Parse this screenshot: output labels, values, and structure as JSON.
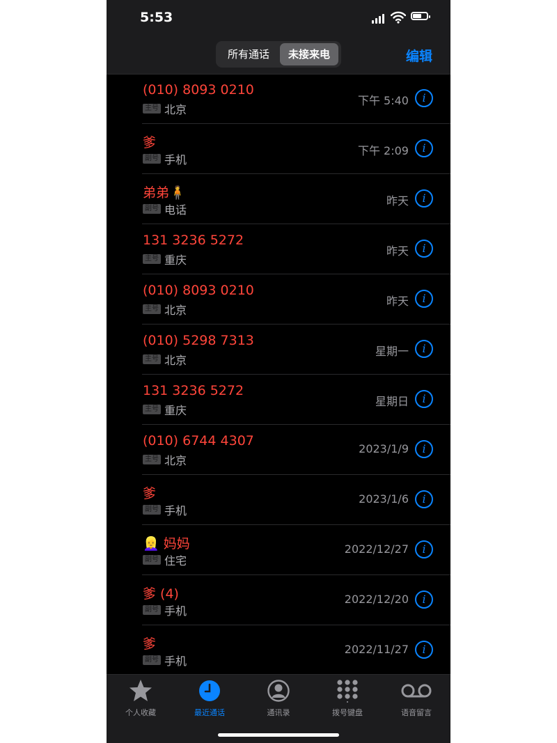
{
  "status": {
    "time": "5:53"
  },
  "segment": {
    "all": "所有通话",
    "missed": "未接来电"
  },
  "nav": {
    "edit": "编辑"
  },
  "calls": [
    {
      "name": "(010) 8093 0210",
      "badge": "主号",
      "label": "北京",
      "when": "下午 5:40"
    },
    {
      "name": "爹",
      "badge": "副号",
      "label": "手机",
      "when": "下午 2:09"
    },
    {
      "name": "弟弟🧍",
      "badge": "副号",
      "label": "电话",
      "when": "昨天"
    },
    {
      "name": "131 3236 5272",
      "badge": "主号",
      "label": "重庆",
      "when": "昨天"
    },
    {
      "name": "(010) 8093 0210",
      "badge": "主号",
      "label": "北京",
      "when": "昨天"
    },
    {
      "name": "(010) 5298 7313",
      "badge": "主号",
      "label": "北京",
      "when": "星期一"
    },
    {
      "name": "131 3236 5272",
      "badge": "主号",
      "label": "重庆",
      "when": "星期日"
    },
    {
      "name": "(010) 6744 4307",
      "badge": "主号",
      "label": "北京",
      "when": "2023/1/9"
    },
    {
      "name": "爹",
      "badge": "副号",
      "label": "手机",
      "when": "2023/1/6"
    },
    {
      "name": "👱‍♀️ 妈妈",
      "badge": "副号",
      "label": "住宅",
      "when": "2022/12/27"
    },
    {
      "name": "爹 (4)",
      "badge": "副号",
      "label": "手机",
      "when": "2022/12/20"
    },
    {
      "name": "爹",
      "badge": "副号",
      "label": "手机",
      "when": "2022/11/27"
    }
  ],
  "tabs": {
    "favorites": "个人收藏",
    "recents": "最近通话",
    "contacts": "通讯录",
    "keypad": "拨号键盘",
    "voicemail": "语音留言"
  },
  "colors": {
    "accent": "#0a84ff",
    "missed": "#ff453a"
  }
}
